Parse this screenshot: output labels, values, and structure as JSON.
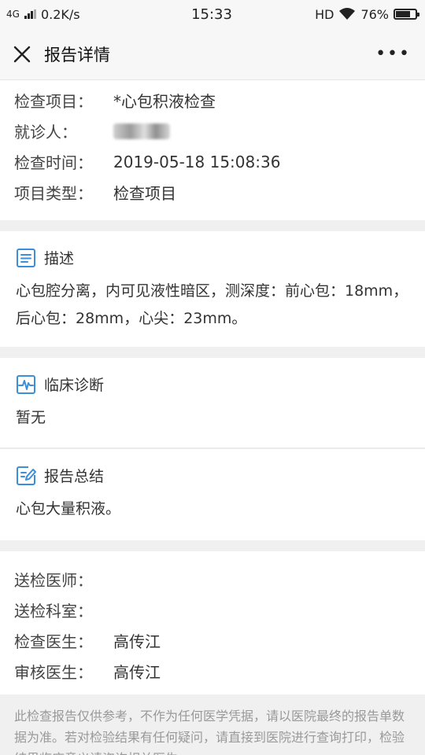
{
  "status": {
    "network": "4G",
    "speed": "0.2K/s",
    "time": "15:33",
    "hd": "HD",
    "battery": "76%",
    "battery_level": 0.76
  },
  "nav": {
    "title": "报告详情",
    "more": "•••"
  },
  "info": [
    {
      "label": "检查项目：",
      "value": "*心包积液检查"
    },
    {
      "label": "就诊人：",
      "value": ""
    },
    {
      "label": "检查时间：",
      "value": "2019-05-18 15:08:36"
    },
    {
      "label": "项目类型：",
      "value": "检查项目"
    }
  ],
  "description": {
    "title": "描述",
    "body": "心包腔分离，内可见液性暗区，测深度：前心包：18mm，后心包：28mm，心尖：23mm。"
  },
  "diagnosis": {
    "title": "临床诊断",
    "body": "暂无"
  },
  "summary": {
    "title": "报告总结",
    "body": "心包大量积液。"
  },
  "doctors": [
    {
      "label": "送检医师：",
      "value": ""
    },
    {
      "label": "送检科室：",
      "value": ""
    },
    {
      "label": "检查医生：",
      "value": "高传江"
    },
    {
      "label": "审核医生：",
      "value": "高传江"
    }
  ],
  "notice": "此检查报告仅供参考，不作为任何医学凭据，请以医院最终的报告单数据为准。若对检验结果有任何疑问，请直接到医院进行查询打印，检验结果临床意义请咨询相关医生。",
  "colors": {
    "accent": "#3b8fd9",
    "notice": "#999999"
  }
}
